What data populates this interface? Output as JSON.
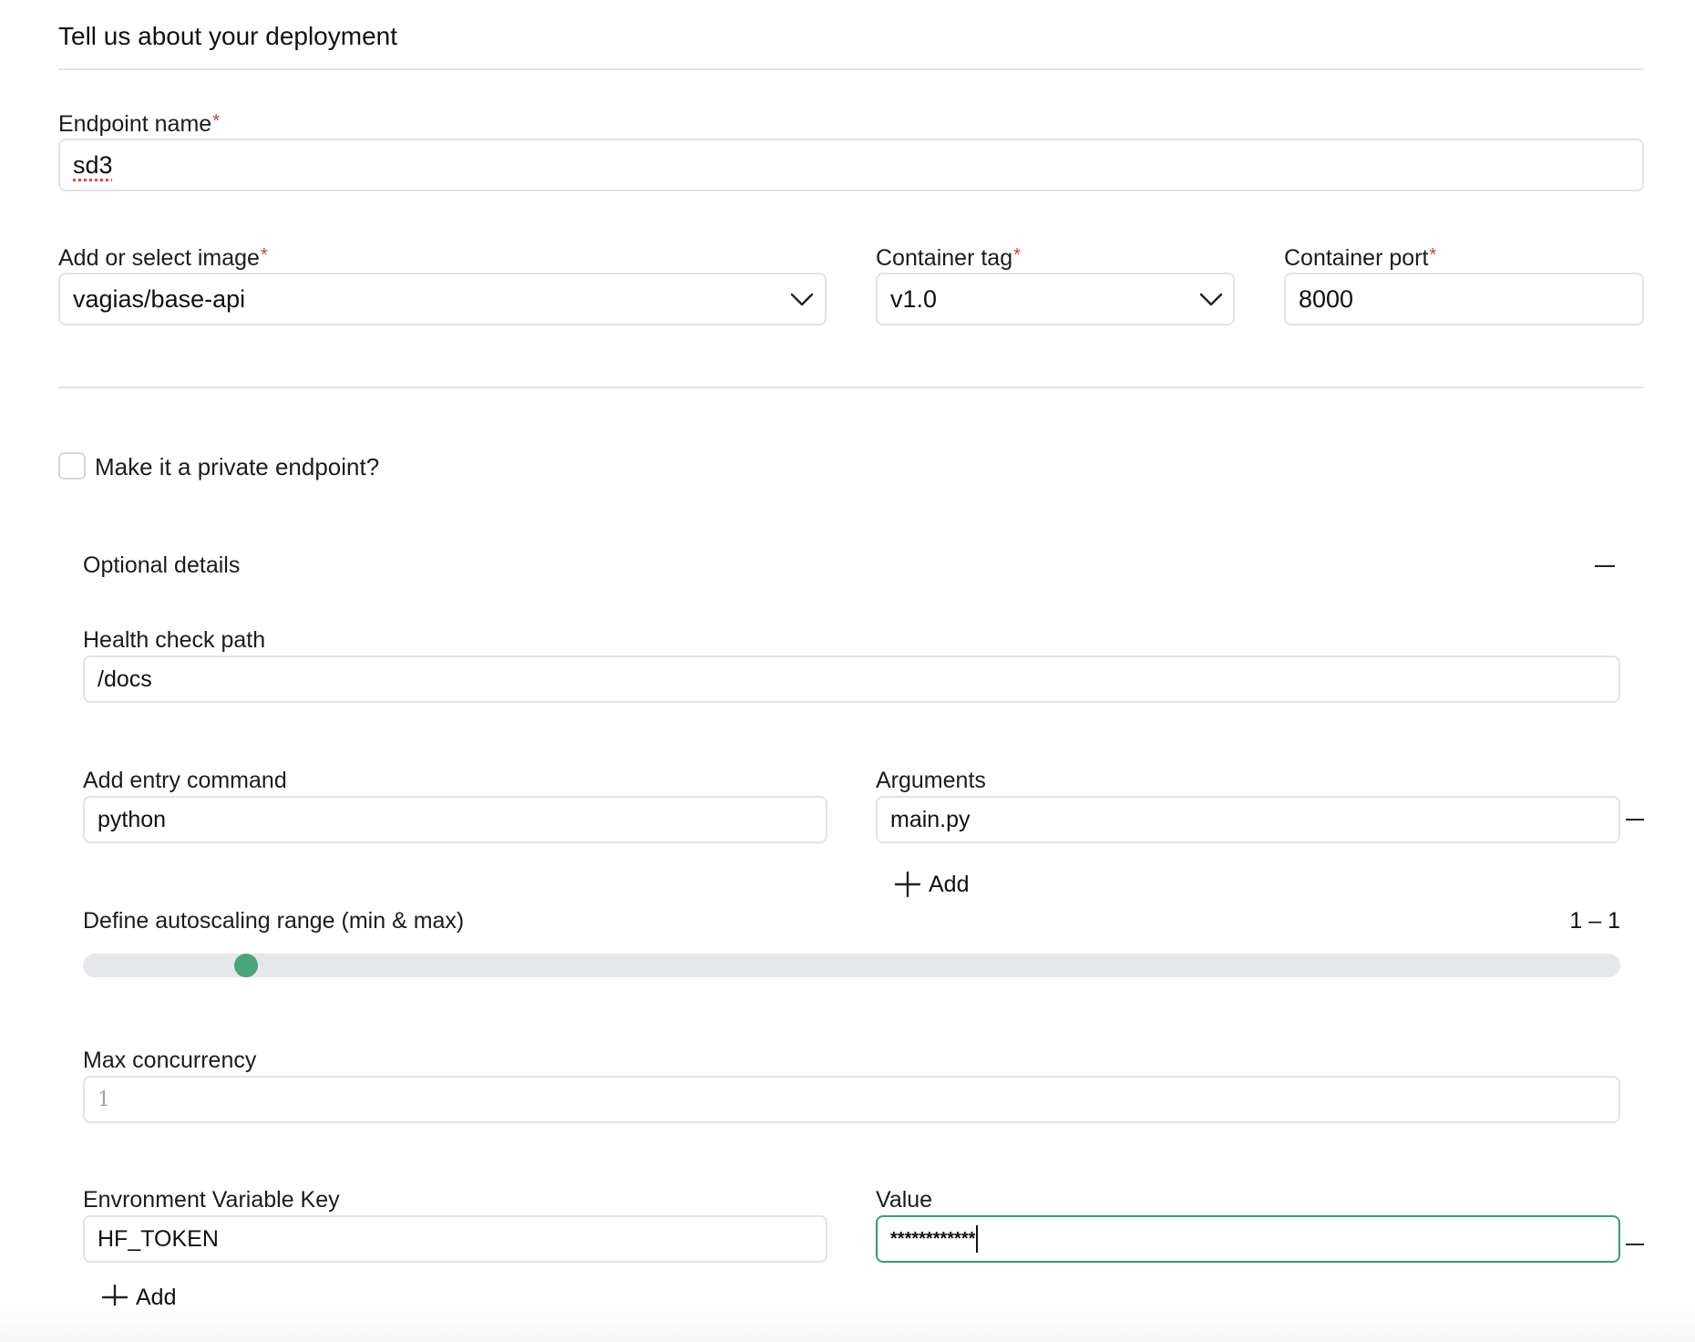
{
  "form": {
    "title": "Tell us about your deployment",
    "required_mark": "*",
    "endpoint_name": {
      "label": "Endpoint name",
      "value": "sd3"
    },
    "image": {
      "label": "Add or select image",
      "value": "vagias/base-api"
    },
    "container_tag": {
      "label": "Container tag",
      "value": "v1.0"
    },
    "container_port": {
      "label": "Container port",
      "value": "8000"
    },
    "private_endpoint": {
      "label": "Make it a private endpoint?",
      "checked": false
    }
  },
  "optional": {
    "title": "Optional details",
    "expanded": true,
    "health_check": {
      "label": "Health check path",
      "value": "/docs"
    },
    "entry_command": {
      "label": "Add entry command",
      "value": "python"
    },
    "arguments": {
      "label": "Arguments",
      "value": "main.py",
      "add_label": "Add"
    },
    "autoscaling": {
      "label": "Define autoscaling range (min & max)",
      "readout": "1 – 1",
      "min": 1,
      "max": 1
    },
    "max_concurrency": {
      "label": "Max concurrency",
      "placeholder": "1"
    },
    "env_var": {
      "key_label": "Envronment Variable Key",
      "key_value": "HF_TOKEN",
      "value_label": "Value",
      "value_masked": "************",
      "add_label": "Add"
    }
  },
  "icons": {
    "dropdown": "chevron-down-icon",
    "collapse": "minus-icon",
    "remove": "minus-icon",
    "add": "plus-icon"
  },
  "colors": {
    "required": "#d63a3a",
    "accent": "#4aa57b",
    "focus_border": "#3a9a72"
  }
}
